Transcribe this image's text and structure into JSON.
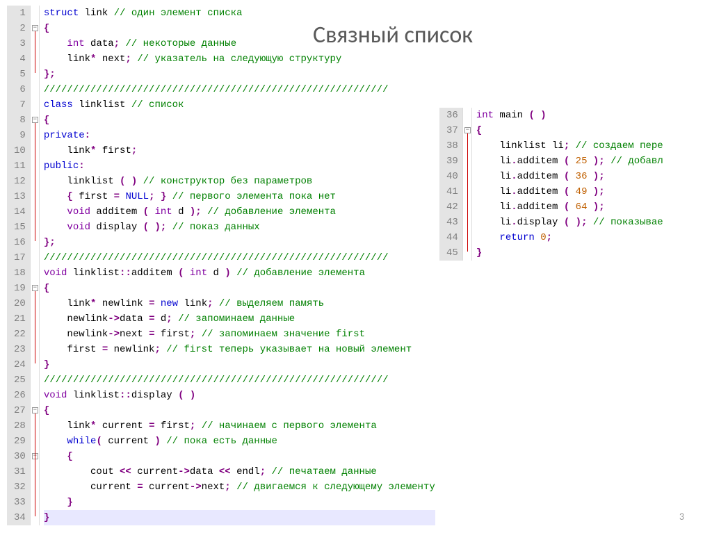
{
  "title": "Связный список",
  "page_number": "3",
  "left": {
    "start": 1,
    "lines": [
      [
        [
          "kw",
          "struct"
        ],
        [
          "id",
          " link "
        ],
        [
          "cm",
          "// один элемент списка"
        ]
      ],
      [
        [
          "op",
          "{"
        ]
      ],
      [
        [
          "id",
          "    "
        ],
        [
          "ty",
          "int"
        ],
        [
          "id",
          " data"
        ],
        [
          "op",
          ";"
        ],
        [
          "id",
          " "
        ],
        [
          "cm",
          "// некоторые данные"
        ]
      ],
      [
        [
          "id",
          "    link"
        ],
        [
          "op",
          "*"
        ],
        [
          "id",
          " next"
        ],
        [
          "op",
          ";"
        ],
        [
          "id",
          " "
        ],
        [
          "cm",
          "// указатель на следующую структуру"
        ]
      ],
      [
        [
          "op",
          "};"
        ]
      ],
      [
        [
          "cm",
          "///////////////////////////////////////////////////////////"
        ]
      ],
      [
        [
          "kw",
          "class"
        ],
        [
          "id",
          " linklist "
        ],
        [
          "cm",
          "// список"
        ]
      ],
      [
        [
          "op",
          "{"
        ]
      ],
      [
        [
          "kw",
          "private"
        ],
        [
          "op",
          ":"
        ]
      ],
      [
        [
          "id",
          "    link"
        ],
        [
          "op",
          "*"
        ],
        [
          "id",
          " first"
        ],
        [
          "op",
          ";"
        ]
      ],
      [
        [
          "kw",
          "public"
        ],
        [
          "op",
          ":"
        ]
      ],
      [
        [
          "id",
          "    linklist "
        ],
        [
          "op",
          "( )"
        ],
        [
          "id",
          " "
        ],
        [
          "cm",
          "// конструктор без параметров"
        ]
      ],
      [
        [
          "id",
          "    "
        ],
        [
          "op",
          "{"
        ],
        [
          "id",
          " first "
        ],
        [
          "op",
          "="
        ],
        [
          "id",
          " "
        ],
        [
          "kw",
          "NULL"
        ],
        [
          "op",
          "; }"
        ],
        [
          "id",
          " "
        ],
        [
          "cm",
          "// первого элемента пока нет"
        ]
      ],
      [
        [
          "id",
          "    "
        ],
        [
          "ty",
          "void"
        ],
        [
          "id",
          " additem "
        ],
        [
          "op",
          "("
        ],
        [
          "id",
          " "
        ],
        [
          "ty",
          "int"
        ],
        [
          "id",
          " d "
        ],
        [
          "op",
          ");"
        ],
        [
          "id",
          " "
        ],
        [
          "cm",
          "// добавление элемента"
        ]
      ],
      [
        [
          "id",
          "    "
        ],
        [
          "ty",
          "void"
        ],
        [
          "id",
          " display "
        ],
        [
          "op",
          "( );"
        ],
        [
          "id",
          " "
        ],
        [
          "cm",
          "// показ данных"
        ]
      ],
      [
        [
          "op",
          "};"
        ]
      ],
      [
        [
          "cm",
          "///////////////////////////////////////////////////////////"
        ]
      ],
      [
        [
          "ty",
          "void"
        ],
        [
          "id",
          " linklist"
        ],
        [
          "op",
          "::"
        ],
        [
          "id",
          "additem "
        ],
        [
          "op",
          "("
        ],
        [
          "id",
          " "
        ],
        [
          "ty",
          "int"
        ],
        [
          "id",
          " d "
        ],
        [
          "op",
          ")"
        ],
        [
          "id",
          " "
        ],
        [
          "cm",
          "// добавление элемента"
        ]
      ],
      [
        [
          "op",
          "{"
        ]
      ],
      [
        [
          "id",
          "    link"
        ],
        [
          "op",
          "*"
        ],
        [
          "id",
          " newlink "
        ],
        [
          "op",
          "="
        ],
        [
          "id",
          " "
        ],
        [
          "kw",
          "new"
        ],
        [
          "id",
          " link"
        ],
        [
          "op",
          ";"
        ],
        [
          "id",
          " "
        ],
        [
          "cm",
          "// выделяем память"
        ]
      ],
      [
        [
          "id",
          "    newlink"
        ],
        [
          "op",
          "->"
        ],
        [
          "id",
          "data "
        ],
        [
          "op",
          "="
        ],
        [
          "id",
          " d"
        ],
        [
          "op",
          ";"
        ],
        [
          "id",
          " "
        ],
        [
          "cm",
          "// запоминаем данные"
        ]
      ],
      [
        [
          "id",
          "    newlink"
        ],
        [
          "op",
          "->"
        ],
        [
          "id",
          "next "
        ],
        [
          "op",
          "="
        ],
        [
          "id",
          " first"
        ],
        [
          "op",
          ";"
        ],
        [
          "id",
          " "
        ],
        [
          "cm",
          "// запоминаем значение first"
        ]
      ],
      [
        [
          "id",
          "    first "
        ],
        [
          "op",
          "="
        ],
        [
          "id",
          " newlink"
        ],
        [
          "op",
          ";"
        ],
        [
          "id",
          " "
        ],
        [
          "cm",
          "// first теперь указывает на новый элемент"
        ]
      ],
      [
        [
          "op",
          "}"
        ]
      ],
      [
        [
          "cm",
          "///////////////////////////////////////////////////////////"
        ]
      ],
      [
        [
          "ty",
          "void"
        ],
        [
          "id",
          " linklist"
        ],
        [
          "op",
          "::"
        ],
        [
          "id",
          "display "
        ],
        [
          "op",
          "( )"
        ]
      ],
      [
        [
          "op",
          "{"
        ]
      ],
      [
        [
          "id",
          "    link"
        ],
        [
          "op",
          "*"
        ],
        [
          "id",
          " current "
        ],
        [
          "op",
          "="
        ],
        [
          "id",
          " first"
        ],
        [
          "op",
          ";"
        ],
        [
          "id",
          " "
        ],
        [
          "cm",
          "// начинаем с первого элемента"
        ]
      ],
      [
        [
          "id",
          "    "
        ],
        [
          "kw",
          "while"
        ],
        [
          "op",
          "("
        ],
        [
          "id",
          " current "
        ],
        [
          "op",
          ")"
        ],
        [
          "id",
          " "
        ],
        [
          "cm",
          "// пока есть данные"
        ]
      ],
      [
        [
          "id",
          "    "
        ],
        [
          "op",
          "{"
        ]
      ],
      [
        [
          "id",
          "        cout "
        ],
        [
          "op",
          "<<"
        ],
        [
          "id",
          " current"
        ],
        [
          "op",
          "->"
        ],
        [
          "id",
          "data "
        ],
        [
          "op",
          "<<"
        ],
        [
          "id",
          " endl"
        ],
        [
          "op",
          ";"
        ],
        [
          "id",
          " "
        ],
        [
          "cm",
          "// печатаем данные"
        ]
      ],
      [
        [
          "id",
          "        current "
        ],
        [
          "op",
          "="
        ],
        [
          "id",
          " current"
        ],
        [
          "op",
          "->"
        ],
        [
          "id",
          "next"
        ],
        [
          "op",
          ";"
        ],
        [
          "id",
          " "
        ],
        [
          "cm",
          "// двигаемся к следующему элементу"
        ]
      ],
      [
        [
          "id",
          "    "
        ],
        [
          "op",
          "}"
        ]
      ],
      [
        [
          "op",
          "}"
        ]
      ]
    ]
  },
  "right": {
    "start": 36,
    "lines": [
      [
        [
          "ty",
          "int"
        ],
        [
          "id",
          " main "
        ],
        [
          "op",
          "( )"
        ]
      ],
      [
        [
          "op",
          "{"
        ]
      ],
      [
        [
          "id",
          "    linklist li"
        ],
        [
          "op",
          ";"
        ],
        [
          "id",
          " "
        ],
        [
          "cm",
          "// создаем пере"
        ]
      ],
      [
        [
          "id",
          "    li"
        ],
        [
          "op",
          "."
        ],
        [
          "id",
          "additem "
        ],
        [
          "op",
          "("
        ],
        [
          "id",
          " "
        ],
        [
          "num",
          "25"
        ],
        [
          "id",
          " "
        ],
        [
          "op",
          ");"
        ],
        [
          "id",
          " "
        ],
        [
          "cm",
          "// добавл"
        ]
      ],
      [
        [
          "id",
          "    li"
        ],
        [
          "op",
          "."
        ],
        [
          "id",
          "additem "
        ],
        [
          "op",
          "("
        ],
        [
          "id",
          " "
        ],
        [
          "num",
          "36"
        ],
        [
          "id",
          " "
        ],
        [
          "op",
          ");"
        ]
      ],
      [
        [
          "id",
          "    li"
        ],
        [
          "op",
          "."
        ],
        [
          "id",
          "additem "
        ],
        [
          "op",
          "("
        ],
        [
          "id",
          " "
        ],
        [
          "num",
          "49"
        ],
        [
          "id",
          " "
        ],
        [
          "op",
          ");"
        ]
      ],
      [
        [
          "id",
          "    li"
        ],
        [
          "op",
          "."
        ],
        [
          "id",
          "additem "
        ],
        [
          "op",
          "("
        ],
        [
          "id",
          " "
        ],
        [
          "num",
          "64"
        ],
        [
          "id",
          " "
        ],
        [
          "op",
          ");"
        ]
      ],
      [
        [
          "id",
          "    li"
        ],
        [
          "op",
          "."
        ],
        [
          "id",
          "display "
        ],
        [
          "op",
          "( );"
        ],
        [
          "id",
          " "
        ],
        [
          "cm",
          "// показывае"
        ]
      ],
      [
        [
          "id",
          "    "
        ],
        [
          "kw",
          "return"
        ],
        [
          "id",
          " "
        ],
        [
          "num",
          "0"
        ],
        [
          "op",
          ";"
        ]
      ],
      [
        [
          "op",
          "}"
        ]
      ]
    ]
  }
}
